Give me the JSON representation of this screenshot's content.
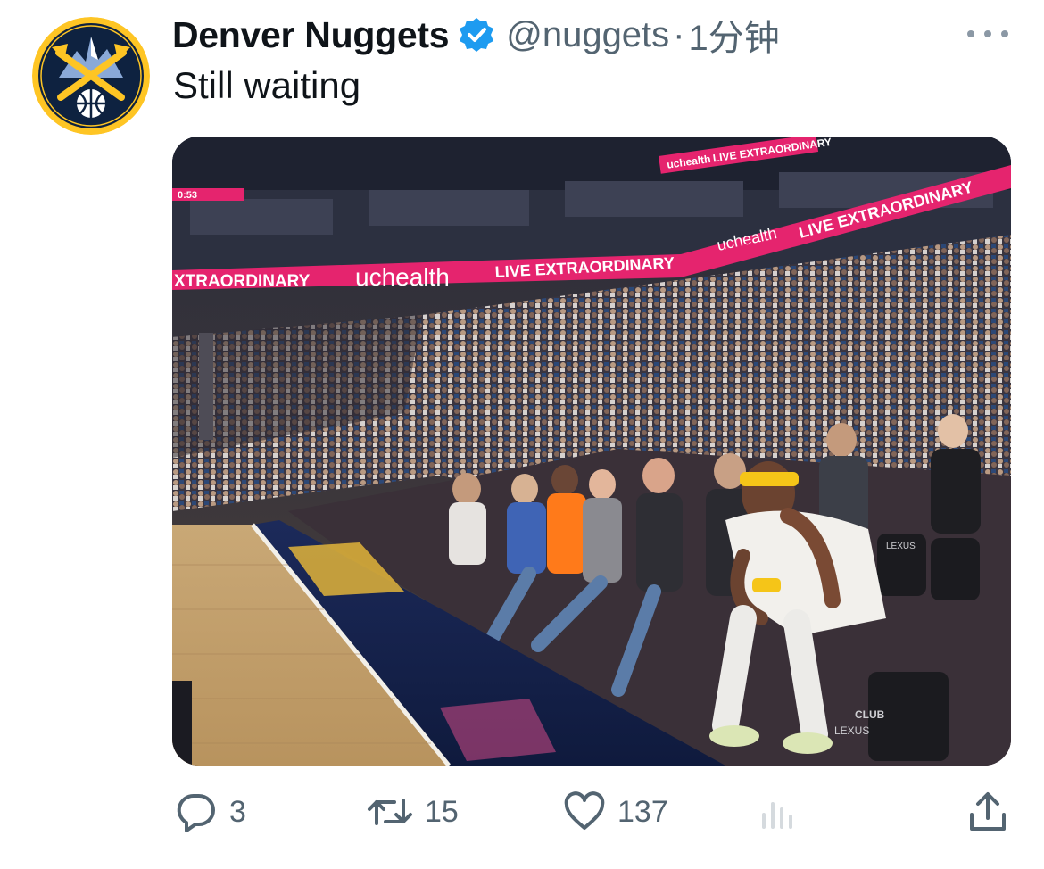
{
  "tweet": {
    "display_name": "Denver Nuggets",
    "handle": "@nuggets",
    "separator": "·",
    "timestamp": "1分钟",
    "text": "Still waiting",
    "verified": true
  },
  "media": {
    "arena_signage": [
      "uchealth",
      "LIVE EXTRAORDINARY",
      "XTRAORDINARY"
    ],
    "scoreboard": "0:53",
    "seat_brand": "LEXUS",
    "seat_label": "CLUB"
  },
  "actions": {
    "reply_count": "3",
    "retweet_count": "15",
    "like_count": "137"
  },
  "colors": {
    "nuggets_navy": "#0e2240",
    "nuggets_gold": "#fec524",
    "verified_blue": "#1d9bf0",
    "ribbon_magenta": "#e5246e",
    "muted_text": "#536471"
  }
}
